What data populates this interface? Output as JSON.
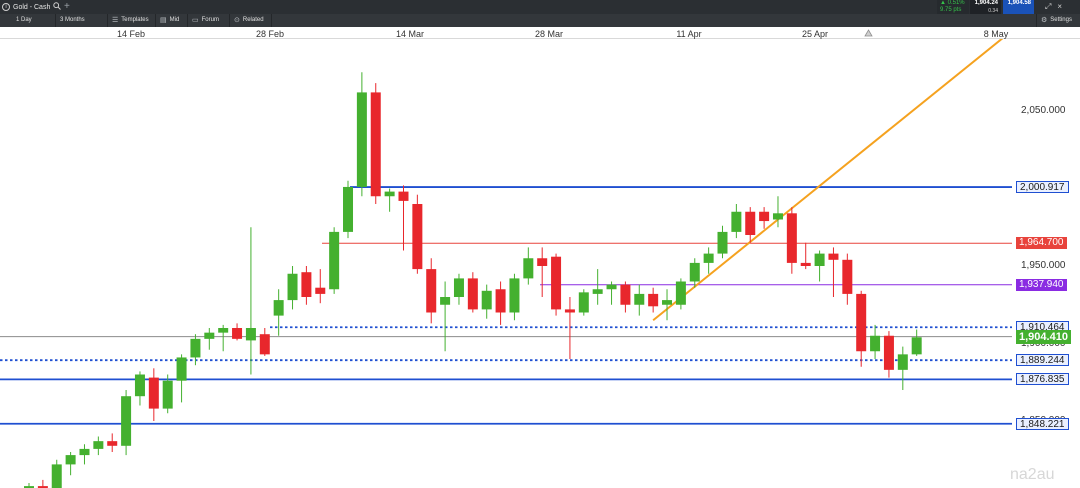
{
  "window": {
    "tab_title": "Gold - Cash",
    "add_tab": "+"
  },
  "quote": {
    "change_pct": "▲ 0.51%",
    "change_pts": "9.75 pts",
    "sell": "1,904.24",
    "buy": "1,904.58",
    "spread": "0.34"
  },
  "toolbar": {
    "interval": "1 Day",
    "range": "3 Months",
    "templates": "Templates",
    "mid": "Mid",
    "forum": "Forum",
    "related": "Related",
    "settings": "Settings"
  },
  "colors": {
    "up": "#44b02f",
    "down": "#e8272c",
    "blue_level": "#1f4fd1",
    "red_level": "#e8433c",
    "purple_level": "#8a2be2",
    "trendline": "#f5a21f",
    "current": "#44b02f"
  },
  "icons": [
    "search-icon",
    "plus-icon",
    "templates-icon",
    "mid-icon",
    "forum-icon",
    "related-icon",
    "settings-icon",
    "expand-icon",
    "close-icon",
    "scroll-marker-icon"
  ],
  "chart_data": {
    "type": "candlestick",
    "instrument": "Gold - Cash",
    "interval": "1 Day",
    "x_ticks": [
      "14 Feb",
      "28 Feb",
      "14 Mar",
      "28 Mar",
      "11 Apr",
      "25 Apr",
      "8 May"
    ],
    "y_ticks": [
      {
        "value": 2050,
        "label": "2,050.000"
      },
      {
        "value": 1950,
        "label": "1,950.000"
      },
      {
        "value": 1900,
        "label": "1,900.000"
      },
      {
        "value": 1850,
        "label": "1,850.000"
      },
      {
        "value": 2000,
        "label": "2,000.000"
      }
    ],
    "ylim": [
      1800,
      2115
    ],
    "levels": [
      {
        "value": 2000.917,
        "label": "2,000.917",
        "color": "#1f4fd1",
        "style": "solid"
      },
      {
        "value": 1964.7,
        "label": "1,964.700",
        "color": "#e8433c",
        "style": "solid"
      },
      {
        "value": 1937.94,
        "label": "1,937.940",
        "color": "#8a2be2",
        "style": "solid"
      },
      {
        "value": 1910.464,
        "label": "1,910.464",
        "color": "#1f4fd1",
        "style": "dotted"
      },
      {
        "value": 1889.244,
        "label": "1,889.244",
        "color": "#1f4fd1",
        "style": "dotted"
      },
      {
        "value": 1876.835,
        "label": "1,876.835",
        "color": "#1f4fd1",
        "style": "solid"
      },
      {
        "value": 1848.221,
        "label": "1,848.221",
        "color": "#1f4fd1",
        "style": "solid"
      }
    ],
    "current": {
      "value": 1904.41,
      "label": "1,904.410"
    },
    "trendline": {
      "from_index": 45,
      "from_value": 1915,
      "to_index": 72,
      "to_value": 2110
    },
    "candles": [
      {
        "o": 1805,
        "h": 1810,
        "l": 1798,
        "c": 1808
      },
      {
        "o": 1808,
        "h": 1812,
        "l": 1803,
        "c": 1806
      },
      {
        "o": 1806,
        "h": 1825,
        "l": 1804,
        "c": 1822
      },
      {
        "o": 1822,
        "h": 1830,
        "l": 1815,
        "c": 1828
      },
      {
        "o": 1828,
        "h": 1835,
        "l": 1822,
        "c": 1832
      },
      {
        "o": 1832,
        "h": 1840,
        "l": 1828,
        "c": 1837
      },
      {
        "o": 1837,
        "h": 1842,
        "l": 1830,
        "c": 1834
      },
      {
        "o": 1834,
        "h": 1870,
        "l": 1828,
        "c": 1866
      },
      {
        "o": 1866,
        "h": 1882,
        "l": 1860,
        "c": 1880
      },
      {
        "o": 1878,
        "h": 1884,
        "l": 1850,
        "c": 1858
      },
      {
        "o": 1858,
        "h": 1880,
        "l": 1855,
        "c": 1876
      },
      {
        "o": 1876,
        "h": 1893,
        "l": 1862,
        "c": 1891
      },
      {
        "o": 1891,
        "h": 1906,
        "l": 1886,
        "c": 1903
      },
      {
        "o": 1903,
        "h": 1910,
        "l": 1896,
        "c": 1907
      },
      {
        "o": 1907,
        "h": 1912,
        "l": 1895,
        "c": 1910
      },
      {
        "o": 1910,
        "h": 1913,
        "l": 1902,
        "c": 1903
      },
      {
        "o": 1902,
        "h": 1975,
        "l": 1880,
        "c": 1910
      },
      {
        "o": 1906,
        "h": 1910,
        "l": 1892,
        "c": 1893
      },
      {
        "o": 1918,
        "h": 1935,
        "l": 1905,
        "c": 1928
      },
      {
        "o": 1928,
        "h": 1950,
        "l": 1922,
        "c": 1945
      },
      {
        "o": 1946,
        "h": 1950,
        "l": 1925,
        "c": 1930
      },
      {
        "o": 1936,
        "h": 1948,
        "l": 1926,
        "c": 1932
      },
      {
        "o": 1935,
        "h": 1975,
        "l": 1932,
        "c": 1972
      },
      {
        "o": 1972,
        "h": 2005,
        "l": 1968,
        "c": 2001
      },
      {
        "o": 2001,
        "h": 2075,
        "l": 1995,
        "c": 2062
      },
      {
        "o": 2062,
        "h": 2068,
        "l": 1990,
        "c": 1995
      },
      {
        "o": 1995,
        "h": 2000,
        "l": 1985,
        "c": 1998
      },
      {
        "o": 1998,
        "h": 2002,
        "l": 1960,
        "c": 1992
      },
      {
        "o": 1990,
        "h": 1996,
        "l": 1945,
        "c": 1948
      },
      {
        "o": 1948,
        "h": 1955,
        "l": 1913,
        "c": 1920
      },
      {
        "o": 1925,
        "h": 1940,
        "l": 1895,
        "c": 1930
      },
      {
        "o": 1930,
        "h": 1945,
        "l": 1925,
        "c": 1942
      },
      {
        "o": 1942,
        "h": 1946,
        "l": 1920,
        "c": 1922
      },
      {
        "o": 1922,
        "h": 1938,
        "l": 1916,
        "c": 1934
      },
      {
        "o": 1935,
        "h": 1940,
        "l": 1912,
        "c": 1920
      },
      {
        "o": 1920,
        "h": 1945,
        "l": 1915,
        "c": 1942
      },
      {
        "o": 1942,
        "h": 1962,
        "l": 1938,
        "c": 1955
      },
      {
        "o": 1955,
        "h": 1962,
        "l": 1930,
        "c": 1950
      },
      {
        "o": 1956,
        "h": 1958,
        "l": 1918,
        "c": 1922
      },
      {
        "o": 1922,
        "h": 1930,
        "l": 1890,
        "c": 1920
      },
      {
        "o": 1920,
        "h": 1935,
        "l": 1918,
        "c": 1933
      },
      {
        "o": 1932,
        "h": 1948,
        "l": 1925,
        "c": 1935
      },
      {
        "o": 1935,
        "h": 1940,
        "l": 1925,
        "c": 1938
      },
      {
        "o": 1938,
        "h": 1940,
        "l": 1920,
        "c": 1925
      },
      {
        "o": 1925,
        "h": 1938,
        "l": 1918,
        "c": 1932
      },
      {
        "o": 1932,
        "h": 1936,
        "l": 1920,
        "c": 1924
      },
      {
        "o": 1925,
        "h": 1935,
        "l": 1915,
        "c": 1928
      },
      {
        "o": 1925,
        "h": 1942,
        "l": 1922,
        "c": 1940
      },
      {
        "o": 1940,
        "h": 1955,
        "l": 1936,
        "c": 1952
      },
      {
        "o": 1952,
        "h": 1962,
        "l": 1945,
        "c": 1958
      },
      {
        "o": 1958,
        "h": 1976,
        "l": 1955,
        "c": 1972
      },
      {
        "o": 1972,
        "h": 1990,
        "l": 1968,
        "c": 1985
      },
      {
        "o": 1985,
        "h": 1988,
        "l": 1965,
        "c": 1970
      },
      {
        "o": 1985,
        "h": 1988,
        "l": 1974,
        "c": 1979
      },
      {
        "o": 1980,
        "h": 1995,
        "l": 1975,
        "c": 1984
      },
      {
        "o": 1984,
        "h": 1988,
        "l": 1945,
        "c": 1952
      },
      {
        "o": 1952,
        "h": 1965,
        "l": 1948,
        "c": 1950
      },
      {
        "o": 1950,
        "h": 1960,
        "l": 1940,
        "c": 1958
      },
      {
        "o": 1958,
        "h": 1962,
        "l": 1930,
        "c": 1954
      },
      {
        "o": 1954,
        "h": 1958,
        "l": 1925,
        "c": 1932
      },
      {
        "o": 1932,
        "h": 1934,
        "l": 1885,
        "c": 1895
      },
      {
        "o": 1895,
        "h": 1912,
        "l": 1890,
        "c": 1905
      },
      {
        "o": 1905,
        "h": 1908,
        "l": 1878,
        "c": 1883
      },
      {
        "o": 1883,
        "h": 1898,
        "l": 1870,
        "c": 1893
      },
      {
        "o": 1893,
        "h": 1909,
        "l": 1892,
        "c": 1904
      }
    ]
  }
}
